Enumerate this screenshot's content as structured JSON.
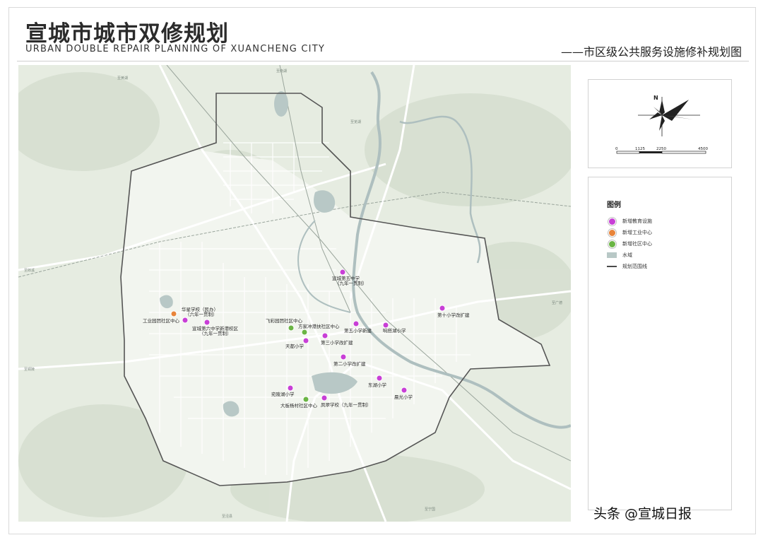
{
  "header": {
    "title_cn": "宣城市城市双修规划",
    "title_en": "URBAN DOUBLE REPAIR PLANNING OF XUANCHENG CITY",
    "subtitle": "——市区级公共服务设施修补规划图"
  },
  "compass": {
    "north": "N",
    "scale_labels": [
      "0",
      "1125",
      "2250",
      "4500"
    ]
  },
  "legend": {
    "title": "图例",
    "items": [
      {
        "label": "新增教育设施",
        "symbol": "magenta-dot-icon",
        "color": "#c83fd6"
      },
      {
        "label": "新增工业中心",
        "symbol": "orange-dot-icon",
        "color": "#e8843a"
      },
      {
        "label": "新增社区中心",
        "symbol": "green-dot-icon",
        "color": "#6ab544"
      },
      {
        "label": "水域",
        "symbol": "water-swatch",
        "color": "#b8c8c6"
      },
      {
        "label": "规划范围线",
        "symbol": "boundary-line",
        "color": "#4a4a4a"
      }
    ]
  },
  "map": {
    "colors": {
      "base": "#e6ece1",
      "urban_fill": "#f2f5ef",
      "green_patch": "#d3ddcd",
      "water": "#b8c8c6",
      "river": "#aebfbf",
      "road": "#ffffff",
      "boundary": "#555555",
      "education": "#c83fd6",
      "industry": "#e8843a",
      "community": "#6ab544"
    },
    "facilities": [
      {
        "type": "education",
        "name_lines": [
          "宣城第五中学",
          "（九年一贯制）"
        ]
      },
      {
        "type": "education",
        "name_lines": [
          "华星学校（民办）",
          "（六年一贯制）"
        ]
      },
      {
        "type": "industry",
        "name_lines": [
          "工业园团社区中心"
        ]
      },
      {
        "type": "education",
        "name_lines": [
          "宣城第六中学新港校区",
          "（九年一贯制）"
        ]
      },
      {
        "type": "community",
        "name_lines": [
          "飞彩园团社区中心"
        ]
      },
      {
        "type": "community",
        "name_lines": [
          "方家冲港扶社区中心"
        ]
      },
      {
        "type": "education",
        "name_lines": [
          "天都小学"
        ]
      },
      {
        "type": "education",
        "name_lines": [
          "第三小学改扩建"
        ]
      },
      {
        "type": "education",
        "name_lines": [
          "第五小学新建"
        ]
      },
      {
        "type": "education",
        "name_lines": [
          "响搭湖小学"
        ]
      },
      {
        "type": "education",
        "name_lines": [
          "第十小学改扩建"
        ]
      },
      {
        "type": "education",
        "name_lines": [
          "第二小学改扩建"
        ]
      },
      {
        "type": "education",
        "name_lines": [
          "东湖小学"
        ]
      },
      {
        "type": "education",
        "name_lines": [
          "晨光小学"
        ]
      },
      {
        "type": "education",
        "name_lines": [
          "宛陵湖小学"
        ]
      },
      {
        "type": "community",
        "name_lines": [
          "大板杨村社区中心"
        ]
      },
      {
        "type": "education",
        "name_lines": [
          "凤翠学校（九年一贯制）"
        ]
      }
    ],
    "road_labels": [
      "至黄湖",
      "至南湖",
      "至芜湖",
      "至宁国",
      "至泾县",
      "至广德",
      "至郎溪",
      "至铜陵"
    ]
  },
  "watermark": "头条 @宣城日报"
}
